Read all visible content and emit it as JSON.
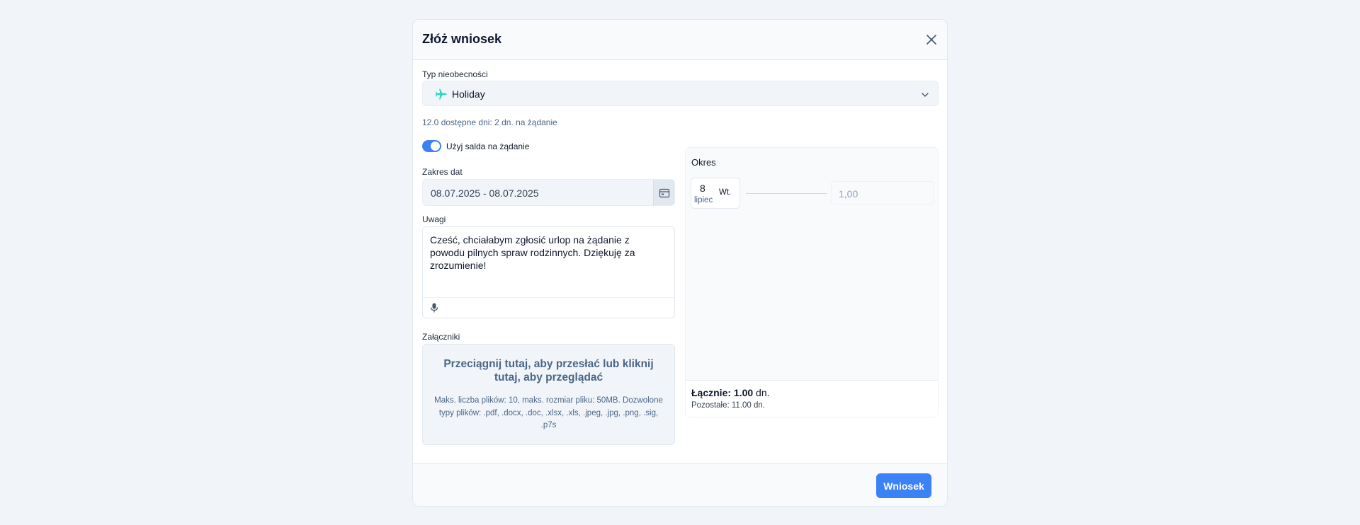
{
  "modal": {
    "title": "Złóż wniosek",
    "close_icon": "close-icon"
  },
  "absence_type": {
    "label": "Typ nieobecności",
    "value": "Holiday",
    "icon": "plane-icon",
    "icon_color": "#2dd4bf"
  },
  "available_text": "12.0 dostępne dni: 2 dn. na żądanie",
  "on_demand_toggle": {
    "label": "Użyj salda na żądanie",
    "checked": true
  },
  "date_range": {
    "label": "Zakres dat",
    "value": "08.07.2025 - 08.07.2025",
    "icon": "calendar-icon"
  },
  "notes": {
    "label": "Uwagi",
    "value": "Cześć, chciałabym zgłosić urlop na żądanie z powodu pilnych spraw rodzinnych. Dziękuję za zrozumienie!",
    "icon": "microphone-icon"
  },
  "attachments": {
    "label": "Załączniki",
    "dropzone_title": "Przeciągnij tutaj, aby przesłać lub kliknij tutaj, aby przeglądać",
    "dropzone_info": "Maks. liczba plików: 10, maks. rozmiar pliku: 50MB. Dozwolone typy plików: .pdf, .docx, .doc, .xlsx, .xls, .jpeg, .jpg, .png, .sig, .p7s"
  },
  "period": {
    "title": "Okres",
    "day": {
      "number": "8",
      "month": "lipiec",
      "weekday": "Wt.",
      "value": "1,00"
    },
    "total_label": "Łącznie:",
    "total_value": "1.00",
    "total_unit": "dn.",
    "remaining": "Pozostałe: 11.00 dn."
  },
  "footer": {
    "submit_label": "Wniosek"
  },
  "colors": {
    "accent": "#3b82f6",
    "muted_text": "#4b6687"
  }
}
